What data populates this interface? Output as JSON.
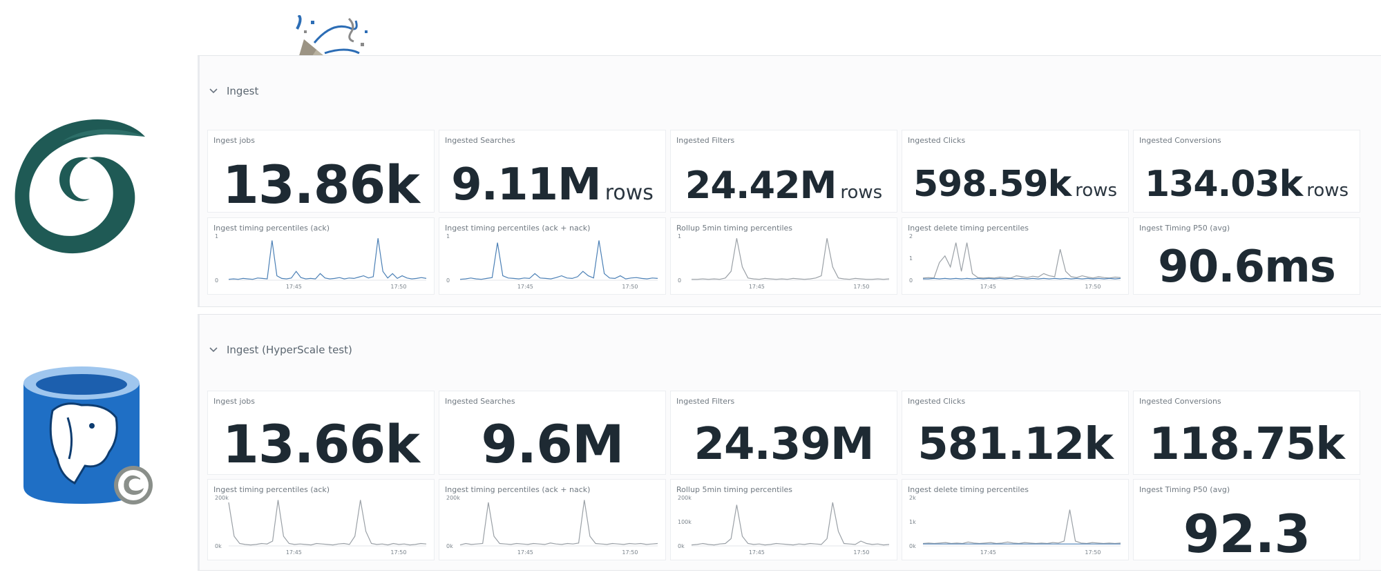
{
  "sections": [
    {
      "title": "Ingest",
      "stats": [
        {
          "label": "Ingest jobs",
          "value": "13.86k",
          "unit": ""
        },
        {
          "label": "Ingested Searches",
          "value": "9.11M",
          "unit": "rows"
        },
        {
          "label": "Ingested Filters",
          "value": "24.42M",
          "unit": "rows"
        },
        {
          "label": "Ingested Clicks",
          "value": "598.59k",
          "unit": "rows"
        },
        {
          "label": "Ingested Conversions",
          "value": "134.03k",
          "unit": "rows"
        }
      ],
      "charts": [
        {
          "label": "Ingest timing percentiles (ack)",
          "y_ticks": [
            "1",
            "0"
          ],
          "x_ticks": [
            "17:45",
            "17:50"
          ],
          "series": [
            {
              "color": "#4a7fb5",
              "values": [
                0.02,
                0.03,
                0.02,
                0.04,
                0.03,
                0.02,
                0.05,
                0.04,
                0.03,
                0.9,
                0.1,
                0.04,
                0.03,
                0.05,
                0.2,
                0.06,
                0.03,
                0.04,
                0.03,
                0.15,
                0.05,
                0.03,
                0.04,
                0.06,
                0.03,
                0.05,
                0.04,
                0.07,
                0.1,
                0.05,
                0.08,
                0.95,
                0.2,
                0.05,
                0.15,
                0.04,
                0.1,
                0.05,
                0.03,
                0.04,
                0.06,
                0.04
              ]
            }
          ]
        },
        {
          "label": "Ingest timing percentiles (ack + nack)",
          "y_ticks": [
            "1",
            "0"
          ],
          "x_ticks": [
            "17:45",
            "17:50"
          ],
          "series": [
            {
              "color": "#4a7fb5",
              "values": [
                0.02,
                0.03,
                0.05,
                0.03,
                0.02,
                0.04,
                0.06,
                0.85,
                0.1,
                0.05,
                0.04,
                0.03,
                0.05,
                0.04,
                0.15,
                0.05,
                0.04,
                0.03,
                0.06,
                0.1,
                0.05,
                0.04,
                0.08,
                0.2,
                0.1,
                0.05,
                0.9,
                0.15,
                0.05,
                0.04,
                0.1,
                0.03,
                0.05,
                0.06,
                0.04,
                0.03,
                0.05,
                0.04
              ]
            }
          ]
        },
        {
          "label": "Rollup 5min timing percentiles",
          "y_ticks": [
            "1",
            "0"
          ],
          "x_ticks": [
            "17:45",
            "17:50"
          ],
          "series": [
            {
              "color": "#9aa0a6",
              "values": [
                0.02,
                0.02,
                0.03,
                0.02,
                0.03,
                0.02,
                0.05,
                0.2,
                0.95,
                0.3,
                0.05,
                0.03,
                0.02,
                0.04,
                0.03,
                0.02,
                0.03,
                0.02,
                0.04,
                0.03,
                0.02,
                0.03,
                0.05,
                0.1,
                0.95,
                0.3,
                0.05,
                0.03,
                0.02,
                0.04,
                0.03,
                0.02,
                0.02,
                0.03,
                0.02,
                0.03
              ]
            }
          ]
        },
        {
          "label": "Ingest delete timing percentiles",
          "y_ticks": [
            "2",
            "1",
            "0"
          ],
          "x_ticks": [
            "17:45",
            "17:50"
          ],
          "series": [
            {
              "color": "#9aa0a6",
              "values": [
                0.05,
                0.06,
                0.05,
                0.4,
                0.55,
                0.3,
                0.85,
                0.2,
                0.85,
                0.15,
                0.06,
                0.05,
                0.06,
                0.05,
                0.07,
                0.06,
                0.05,
                0.1,
                0.08,
                0.06,
                0.09,
                0.07,
                0.15,
                0.1,
                0.08,
                0.7,
                0.2,
                0.08,
                0.06,
                0.1,
                0.07,
                0.05,
                0.08,
                0.06,
                0.05,
                0.07,
                0.06
              ]
            },
            {
              "color": "#4a7fb5",
              "values": [
                0.03,
                0.03,
                0.04,
                0.03,
                0.04,
                0.03,
                0.04,
                0.03,
                0.04,
                0.03,
                0.04,
                0.03,
                0.04,
                0.03,
                0.04,
                0.03,
                0.04,
                0.03,
                0.04,
                0.03,
                0.04,
                0.03,
                0.04,
                0.03,
                0.04,
                0.03,
                0.04,
                0.03,
                0.04,
                0.03,
                0.04,
                0.03,
                0.04,
                0.03,
                0.04,
                0.03,
                0.04
              ]
            }
          ]
        }
      ],
      "timing": {
        "label": "Ingest Timing P50 (avg)",
        "value": "90.6ms"
      }
    },
    {
      "title": "Ingest (HyperScale test)",
      "stats": [
        {
          "label": "Ingest jobs",
          "value": "13.66k",
          "unit": ""
        },
        {
          "label": "Ingested Searches",
          "value": "9.6M",
          "unit": ""
        },
        {
          "label": "Ingested Filters",
          "value": "24.39M",
          "unit": ""
        },
        {
          "label": "Ingested Clicks",
          "value": "581.12k",
          "unit": ""
        },
        {
          "label": "Ingested Conversions",
          "value": "118.75k",
          "unit": ""
        }
      ],
      "charts": [
        {
          "label": "Ingest timing percentiles (ack)",
          "y_ticks": [
            "200k",
            "0k"
          ],
          "x_ticks": [
            "17:45",
            "17:50"
          ],
          "series": [
            {
              "color": "#9aa0a6",
              "values": [
                0.9,
                0.2,
                0.05,
                0.03,
                0.02,
                0.03,
                0.05,
                0.04,
                0.1,
                0.95,
                0.2,
                0.05,
                0.03,
                0.04,
                0.03,
                0.02,
                0.05,
                0.04,
                0.03,
                0.02,
                0.04,
                0.05,
                0.03,
                0.2,
                0.95,
                0.3,
                0.05,
                0.03,
                0.04,
                0.02,
                0.05,
                0.03,
                0.04,
                0.02,
                0.03,
                0.05,
                0.04
              ]
            }
          ]
        },
        {
          "label": "Ingest timing percentiles (ack + nack)",
          "y_ticks": [
            "200k",
            "0k"
          ],
          "x_ticks": [
            "17:45",
            "17:50"
          ],
          "series": [
            {
              "color": "#9aa0a6",
              "values": [
                0.02,
                0.05,
                0.03,
                0.04,
                0.05,
                0.9,
                0.2,
                0.05,
                0.04,
                0.03,
                0.05,
                0.04,
                0.03,
                0.05,
                0.04,
                0.03,
                0.06,
                0.04,
                0.03,
                0.05,
                0.04,
                0.06,
                0.95,
                0.2,
                0.05,
                0.04,
                0.03,
                0.05,
                0.04,
                0.03,
                0.05,
                0.04,
                0.05,
                0.03,
                0.04,
                0.05
              ]
            }
          ]
        },
        {
          "label": "Rollup 5min timing percentiles",
          "y_ticks": [
            "200k",
            "100k",
            "0k"
          ],
          "x_ticks": [
            "17:45",
            "17:50"
          ],
          "series": [
            {
              "color": "#9aa0a6",
              "values": [
                0.02,
                0.03,
                0.05,
                0.03,
                0.02,
                0.04,
                0.05,
                0.15,
                0.85,
                0.2,
                0.05,
                0.03,
                0.04,
                0.02,
                0.03,
                0.05,
                0.04,
                0.03,
                0.02,
                0.04,
                0.03,
                0.05,
                0.04,
                0.03,
                0.15,
                0.9,
                0.3,
                0.05,
                0.04,
                0.03,
                0.1,
                0.05,
                0.03,
                0.04,
                0.02,
                0.03
              ]
            }
          ]
        },
        {
          "label": "Ingest delete timing percentiles",
          "y_ticks": [
            "2k",
            "1k",
            "0k"
          ],
          "x_ticks": [
            "17:45",
            "17:50"
          ],
          "series": [
            {
              "color": "#9aa0a6",
              "values": [
                0.05,
                0.06,
                0.05,
                0.06,
                0.07,
                0.05,
                0.06,
                0.05,
                0.08,
                0.06,
                0.05,
                0.06,
                0.07,
                0.05,
                0.06,
                0.08,
                0.06,
                0.05,
                0.07,
                0.06,
                0.05,
                0.06,
                0.05,
                0.07,
                0.06,
                0.1,
                0.75,
                0.1,
                0.06,
                0.05,
                0.07,
                0.06,
                0.05,
                0.06,
                0.05,
                0.06
              ]
            },
            {
              "color": "#4a7fb5",
              "values": [
                0.04,
                0.04,
                0.04,
                0.04,
                0.04,
                0.04,
                0.04,
                0.04,
                0.04,
                0.04,
                0.04,
                0.04,
                0.04,
                0.04,
                0.04,
                0.04,
                0.04,
                0.04,
                0.04,
                0.04,
                0.04,
                0.04,
                0.04,
                0.04,
                0.04,
                0.04,
                0.04,
                0.04,
                0.04,
                0.04,
                0.04,
                0.04,
                0.04,
                0.04,
                0.04,
                0.04
              ]
            }
          ]
        }
      ],
      "timing": {
        "label": "Ingest Timing P50 (avg)",
        "value": "92.3"
      }
    }
  ]
}
